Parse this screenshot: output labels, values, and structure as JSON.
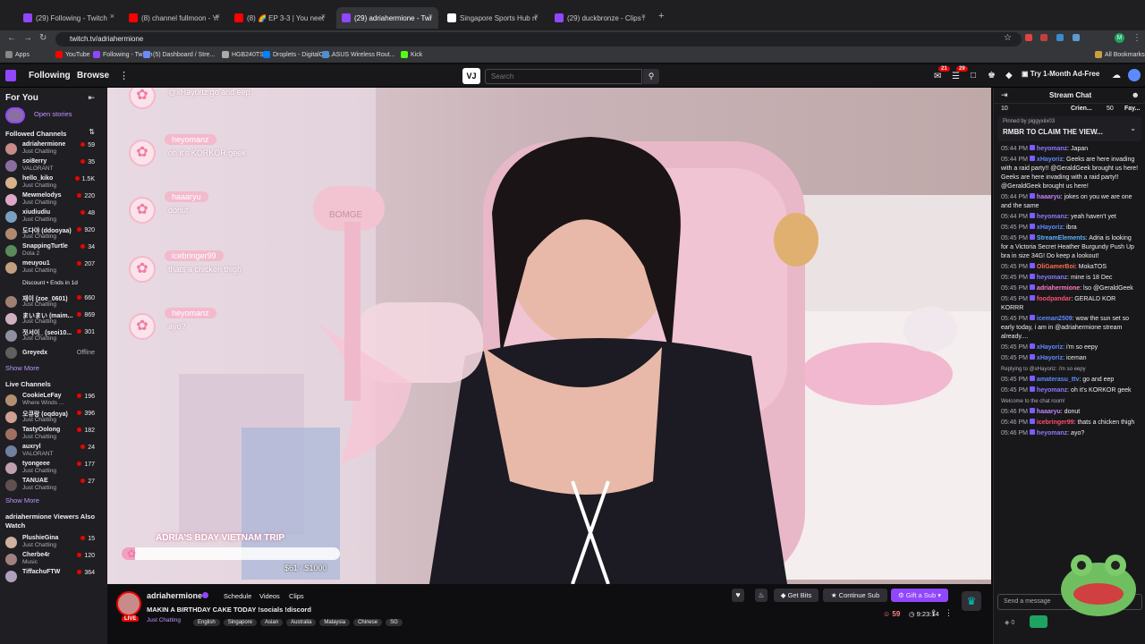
{
  "browser": {
    "tabs": [
      {
        "label": "(29) Following - Twitch",
        "color": "#9146ff"
      },
      {
        "label": "(8) channel fullmoon - YouTube",
        "color": "#ff0000"
      },
      {
        "label": "(8) 🌈 EP 3-3 | You need to",
        "color": "#ff0000"
      },
      {
        "label": "(29) adriahermione - Twitch",
        "color": "#9146ff"
      },
      {
        "label": "Singapore Sports Hub rename",
        "color": "#ffffff"
      },
      {
        "label": "(29) duckbronze - Clips Manag",
        "color": "#9146ff"
      }
    ],
    "active_tab": 3,
    "url": "twitch.tv/adriahermione",
    "bookmarks": [
      "Apps",
      "YouTube",
      "Following - Twitch",
      "(5) Dashboard / Stre...",
      "HGB240TS",
      "Droplets - DigitalOc...",
      "ASUS Wireless Rout...",
      "Kick"
    ],
    "all_bookmarks": "All Bookmarks"
  },
  "topnav": {
    "following": "Following",
    "browse": "Browse",
    "search_placeholder": "Search",
    "notif_count": "21",
    "inbox_count": "29",
    "turbo": "Try 1-Month Ad-Free"
  },
  "sidebar": {
    "for_you": "For You",
    "open_stories": "Open stories",
    "followed_title": "Followed Channels",
    "followed": [
      {
        "name": "adriahermione",
        "game": "Just Chatting",
        "viewers": "59",
        "color": "#c98a8a"
      },
      {
        "name": "soi8erry",
        "game": "VALORANT",
        "viewers": "35",
        "color": "#8a6e9e"
      },
      {
        "name": "hello_kiko",
        "game": "Just Chatting",
        "viewers": "1.5K",
        "color": "#d8b08a"
      },
      {
        "name": "Mewmelodys",
        "game": "Just Chatting",
        "viewers": "220",
        "color": "#e0a6c8"
      },
      {
        "name": "xiudiudiu",
        "game": "Just Chatting",
        "viewers": "48",
        "color": "#7aa0c0"
      },
      {
        "name": "도다야 (ddooyaa)",
        "game": "Just Chatting",
        "viewers": "920",
        "color": "#b08a70"
      },
      {
        "name": "SnappingTurtle",
        "game": "Dota 2",
        "viewers": "34",
        "color": "#5a8a5a"
      },
      {
        "name": "meuyou1",
        "game": "Just Chatting",
        "viewers": "207",
        "color": "#c0a080"
      },
      {
        "name": "",
        "game": "Discount • Ends in 1d",
        "viewers": "",
        "color": "#18181b"
      },
      {
        "name": "재이 (zoe_0601)",
        "game": "Just Chatting",
        "viewers": "660",
        "color": "#a08070"
      },
      {
        "name": "まいまい (maim...",
        "game": "Just Chatting",
        "viewers": "869",
        "color": "#d0b0c0"
      },
      {
        "name": "젓서이_ (seoi10...",
        "game": "Just Chatting",
        "viewers": "301",
        "color": "#9090a0"
      },
      {
        "name": "Greyedx",
        "game": "",
        "viewers": "Offline",
        "color": "#606060"
      }
    ],
    "show_more": "Show More",
    "live_title": "Live Channels",
    "live": [
      {
        "name": "CookieLeFay",
        "game": "Where Winds ...",
        "viewers": "196",
        "color": "#b09070"
      },
      {
        "name": "오큐랑 (oqdoya)",
        "game": "Just Chatting",
        "viewers": "396",
        "color": "#d0a090"
      },
      {
        "name": "TastyOolong",
        "game": "Just Chatting",
        "viewers": "182",
        "color": "#a07060"
      },
      {
        "name": "auxryl",
        "game": "VALORANT",
        "viewers": "24",
        "color": "#7080a0"
      },
      {
        "name": "tyongeee",
        "game": "Just Chatting",
        "viewers": "177",
        "color": "#c0a0b0"
      },
      {
        "name": "TANUAE",
        "game": "Just Chatting",
        "viewers": "27",
        "color": "#605050"
      }
    ],
    "show_more_2": "Show More",
    "also_watch_title": "adriahermione Viewers Also Watch",
    "also_watch": [
      {
        "name": "PlushieGina",
        "game": "Just Chatting",
        "viewers": "15",
        "color": "#d0b0a0"
      },
      {
        "name": "Cherbe4r",
        "game": "Music",
        "viewers": "120",
        "color": "#a08080"
      },
      {
        "name": "TiffachuFTW",
        "game": "",
        "viewers": "364",
        "color": "#b0a0c0"
      }
    ]
  },
  "overlay": {
    "chat_bubbles": [
      {
        "user": "",
        "text": "@xHayoriz go and eep"
      },
      {
        "user": "heyomanz",
        "text": "oh it's KORKOR geek"
      },
      {
        "user": "haaaryu",
        "text": "donut"
      },
      {
        "user": "icebringer99",
        "text": "thats a chicken thigh"
      },
      {
        "user": "heyomanz",
        "text": "ayo?"
      }
    ],
    "goal_title": "ADRIA'S BDAY VIETNAM TRIP",
    "goal_amount": "$61 / $1000",
    "goal_fraction": 0.061,
    "mic_text": "BOMGE"
  },
  "info": {
    "channel": "adriahermione",
    "live_badge": "LIVE",
    "links": [
      "Schedule",
      "Videos",
      "Clips"
    ],
    "title": "MAKIN A BIRTHDAY CAKE TODAY !socials !discord",
    "category": "Just Chatting",
    "tags": [
      "English",
      "Singapore",
      "Asian",
      "Australia",
      "Malaysia",
      "Chinese",
      "SG"
    ],
    "get_bits": "Get Bits",
    "continue_sub": "Continue Sub",
    "gift_sub": "Gift a Sub",
    "viewers": "59",
    "uptime": "9:23:14"
  },
  "chat": {
    "title": "Stream Chat",
    "leaderboard": [
      "10",
      "Crien...",
      "50",
      "Fay..."
    ],
    "pinned_by": "Pinned by piggyxiix03",
    "pinned_text": "RMBR TO CLAIM THE VIEW...",
    "messages": [
      {
        "ts": "05:44 PM",
        "user": "heyomanz",
        "color": "#8a7bff",
        "text": ": Japan"
      },
      {
        "ts": "05:44 PM",
        "user": "xHayoriz",
        "color": "#5c8aff",
        "text": ": Geeks are here invading with a raid party!! @GeraldGeek brought us here! Geeks are here invading with a raid party!! @GeraldGeek brought us here!"
      },
      {
        "ts": "05:44 PM",
        "user": "haaaryu",
        "color": "#c084fc",
        "text": ": jokes on you we are one and the same"
      },
      {
        "ts": "05:44 PM",
        "user": "heyomanz",
        "color": "#8a7bff",
        "text": ": yeah haven't yet"
      },
      {
        "ts": "05:45 PM",
        "user": "xHayoriz",
        "color": "#5c8aff",
        "text": ": ibra"
      },
      {
        "ts": "05:45 PM",
        "user": "StreamElements",
        "color": "#5cb0ff",
        "text": ": Adria is looking for a Victoria Secret Heather Burgundy Push Up bra in size 34G! Do keep a lookout!"
      },
      {
        "ts": "05:45 PM",
        "user": "OliGamerBoi",
        "color": "#ff6a4d",
        "text": ": MokaTOS"
      },
      {
        "ts": "05:45 PM",
        "user": "heyomanz",
        "color": "#8a7bff",
        "text": ": mine is 18 Dec"
      },
      {
        "ts": "05:45 PM",
        "user": "adriahermione",
        "color": "#ff7ac6",
        "text": ": lso @GeraldGeek"
      },
      {
        "ts": "05:45 PM",
        "user": "foodpandar",
        "color": "#ff4d6a",
        "text": ": GERALD KOR KORRR"
      },
      {
        "ts": "05:45 PM",
        "user": "iceman2509",
        "color": "#5c8aff",
        "text": ": wow the sun set so early today, i am in @adriahermione stream already...."
      },
      {
        "ts": "05:45 PM",
        "user": "xHayoriz",
        "color": "#5c8aff",
        "text": ": i'm so eepy"
      },
      {
        "ts": "05:45 PM",
        "user": "xHayoriz",
        "color": "#5c8aff",
        "text": ": iceman"
      },
      {
        "ts": "",
        "user": "",
        "color": "#adadb8",
        "text": "Replying to @xHayoriz: i'm so eepy"
      },
      {
        "ts": "05:45 PM",
        "user": "amaterasu_ttv",
        "color": "#5c8aff",
        "text": ": go and eep"
      },
      {
        "ts": "05:45 PM",
        "user": "heyomanz",
        "color": "#8a7bff",
        "text": ": oh it's KORKOR geek"
      },
      {
        "ts": "",
        "user": "",
        "color": "#adadb8",
        "text": "Welcome to the chat room!"
      },
      {
        "ts": "05:46 PM",
        "user": "haaaryu",
        "color": "#c084fc",
        "text": ": donut"
      },
      {
        "ts": "05:46 PM",
        "user": "icebringer99",
        "color": "#ff4d6a",
        "text": ": thats a chicken thigh"
      },
      {
        "ts": "05:46 PM",
        "user": "heyomanz",
        "color": "#8a7bff",
        "text": ": ayo?"
      }
    ],
    "input_placeholder": "Send a message",
    "points": "0"
  },
  "colors": {
    "accent": "#9146ff",
    "live": "#eb0400"
  }
}
